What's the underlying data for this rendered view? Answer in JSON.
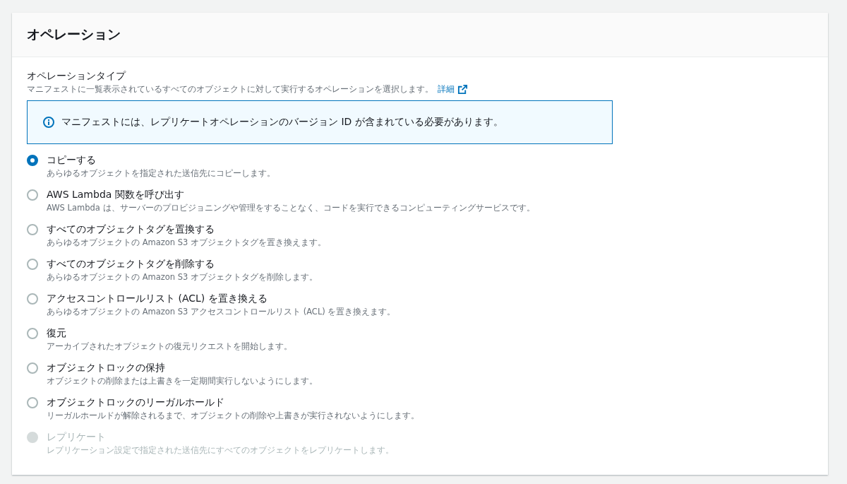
{
  "panel": {
    "title": "オペレーション"
  },
  "field": {
    "label": "オペレーションタイプ",
    "description": "マニフェストに一覧表示されているすべてのオブジェクトに対して実行するオペレーションを選択します。",
    "link": "詳細"
  },
  "info_alert": {
    "text": "マニフェストには、レプリケートオペレーションのバージョン ID が含まれている必要があります。"
  },
  "options": [
    {
      "label": "コピーする",
      "description": "あらゆるオブジェクトを指定された送信先にコピーします。",
      "selected": true,
      "disabled": false
    },
    {
      "label": "AWS Lambda 関数を呼び出す",
      "description": "AWS Lambda は、サーバーのプロビジョニングや管理をすることなく、コードを実行できるコンピューティングサービスです。",
      "selected": false,
      "disabled": false
    },
    {
      "label": "すべてのオブジェクトタグを置換する",
      "description": "あらゆるオブジェクトの Amazon S3 オブジェクトタグを置き換えます。",
      "selected": false,
      "disabled": false
    },
    {
      "label": "すべてのオブジェクトタグを削除する",
      "description": "あらゆるオブジェクトの Amazon S3 オブジェクトタグを削除します。",
      "selected": false,
      "disabled": false
    },
    {
      "label": "アクセスコントロールリスト (ACL) を置き換える",
      "description": "あらゆるオブジェクトの Amazon S3 アクセスコントロールリスト (ACL) を置き換えます。",
      "selected": false,
      "disabled": false
    },
    {
      "label": "復元",
      "description": "アーカイブされたオブジェクトの復元リクエストを開始します。",
      "selected": false,
      "disabled": false
    },
    {
      "label": "オブジェクトロックの保持",
      "description": "オブジェクトの削除または上書きを一定期間実行しないようにします。",
      "selected": false,
      "disabled": false
    },
    {
      "label": "オブジェクトロックのリーガルホールド",
      "description": "リーガルホールドが解除されるまで、オブジェクトの削除や上書きが実行されないようにします。",
      "selected": false,
      "disabled": false
    },
    {
      "label": "レプリケート",
      "description": "レプリケーション設定で指定された送信先にすべてのオブジェクトをレプリケートします。",
      "selected": false,
      "disabled": true
    }
  ]
}
